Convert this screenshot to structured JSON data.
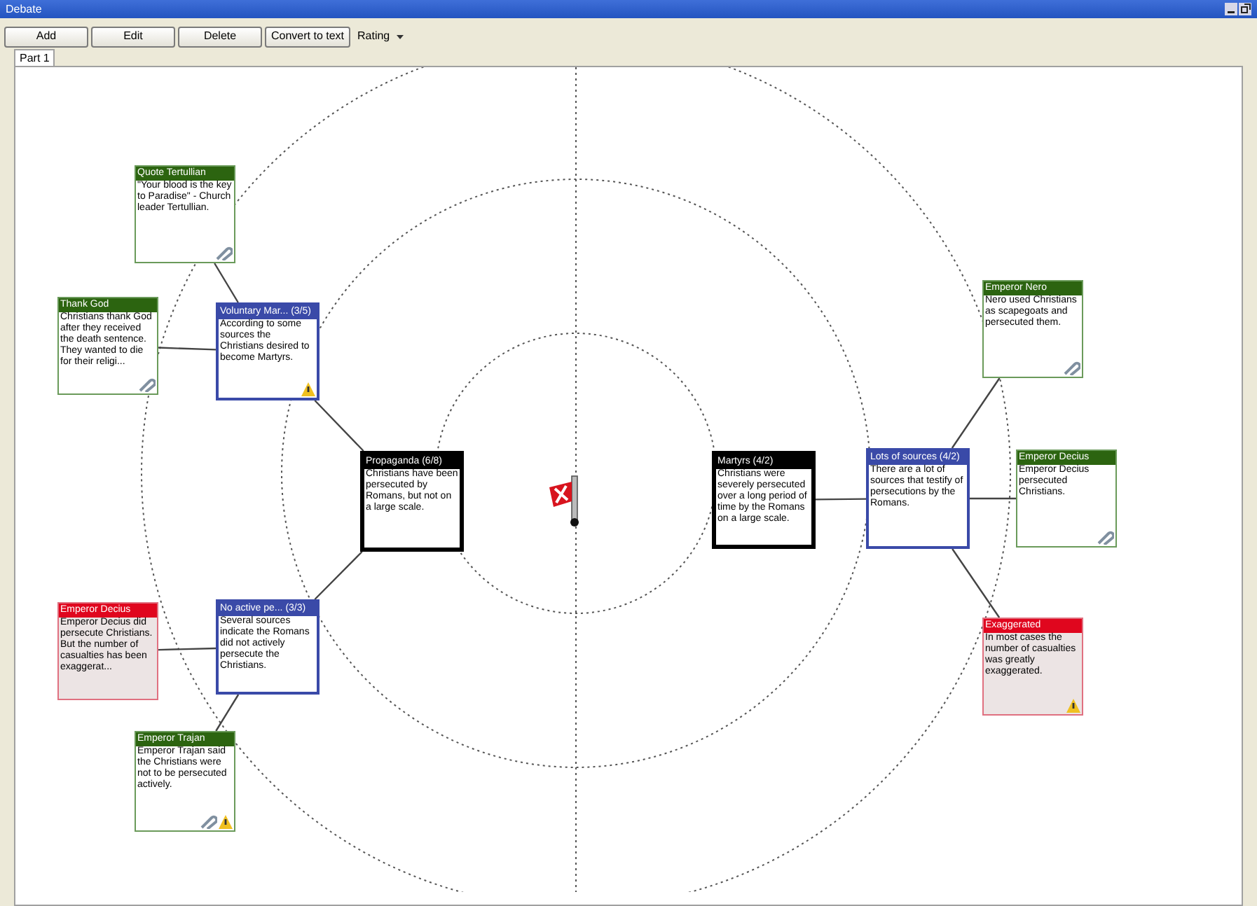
{
  "window": {
    "title": "Debate"
  },
  "toolbar": {
    "buttons": [
      "Add",
      "Edit",
      "Delete",
      "Convert to text"
    ],
    "dropdown": {
      "label": "Rating"
    }
  },
  "tabs": [
    {
      "label": "Part 1",
      "selected": true
    }
  ],
  "map": {
    "theses": [
      {
        "kind": "thesis",
        "title": "Propaganda (6/8)",
        "text": "Christians have been persecuted by Romans, but not on a large scale.",
        "attachment": false,
        "warning": false,
        "children": [
          {
            "kind": "argument",
            "title": "Voluntary Mar... (3/5)",
            "text": "According to some sources the Christians desired to become Martyrs.",
            "attachment": false,
            "warning": true,
            "children": [
              {
                "kind": "pro",
                "title": "Quote Tertullian",
                "text": "\"Your blood is the key to Paradise\" - Church leader Tertullian.",
                "attachment": true,
                "warning": false
              },
              {
                "kind": "pro",
                "title": "Thank God",
                "text": "Christians thank God after they received the death sentence. They wanted to die for their religi...",
                "attachment": true,
                "warning": false
              }
            ]
          },
          {
            "kind": "argument",
            "title": "No active pe... (3/3)",
            "text": "Several sources indicate the Romans did not actively persecute the Christians.",
            "attachment": false,
            "warning": false,
            "children": [
              {
                "kind": "con",
                "title": "Emperor Decius",
                "text": "Emperor Decius did persecute Christians. But the number of casualties has been exaggerat...",
                "attachment": false,
                "warning": false
              },
              {
                "kind": "pro",
                "title": "Emperor Trajan",
                "text": "Emperor Trajan said the Christians were not to be persecuted actively.",
                "attachment": true,
                "warning": true
              }
            ]
          }
        ]
      },
      {
        "kind": "thesis",
        "title": "Martyrs (4/2)",
        "text": "Christians were severely persecuted over a long period of time by the Romans on a large scale.",
        "attachment": false,
        "warning": false,
        "children": [
          {
            "kind": "argument",
            "title": "Lots of sources (4/2)",
            "text": "There are a lot of sources that testify of persecutions by the Romans.",
            "attachment": false,
            "warning": false,
            "children": [
              {
                "kind": "pro",
                "title": "Emperor Nero",
                "text": "Nero used Christians as scapegoats and persecuted them.",
                "attachment": true,
                "warning": false
              },
              {
                "kind": "pro",
                "title": "Emperor Decius",
                "text": "Emperor Decius persecuted Christians.",
                "attachment": true,
                "warning": false
              },
              {
                "kind": "con",
                "title": "Exaggerated",
                "text": "In most cases the number of casualties was greatly exaggerated.",
                "attachment": false,
                "warning": true
              }
            ]
          }
        ]
      }
    ]
  }
}
